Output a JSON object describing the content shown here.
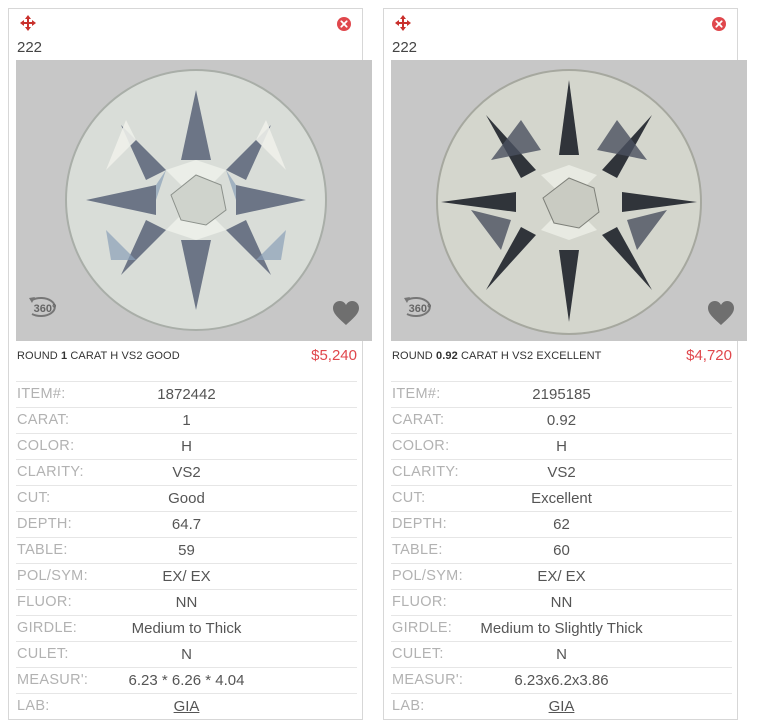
{
  "colors": {
    "price": "#e0474c",
    "close": "#e0474c",
    "move": "#c9302c",
    "label": "#b2b2b2"
  },
  "cards": [
    {
      "number": "222",
      "shape": "ROUND",
      "carat": "1",
      "desc_rest": "CARAT H VS2 GOOD",
      "price": "$5,240",
      "icons": {
        "move": "move-icon",
        "close": "close-icon",
        "view360": "360-view-icon",
        "fav": "heart-icon"
      },
      "specs": [
        {
          "label": "ITEM#:",
          "value": "1872442"
        },
        {
          "label": "CARAT:",
          "value": "1"
        },
        {
          "label": "COLOR:",
          "value": "H"
        },
        {
          "label": "CLARITY:",
          "value": "VS2"
        },
        {
          "label": "CUT:",
          "value": "Good"
        },
        {
          "label": "DEPTH:",
          "value": "64.7"
        },
        {
          "label": "TABLE:",
          "value": "59"
        },
        {
          "label": "POL/SYM:",
          "value": "EX/ EX"
        },
        {
          "label": "FLUOR:",
          "value": "NN"
        },
        {
          "label": "GIRDLE:",
          "value": "Medium to Thick"
        },
        {
          "label": "CULET:",
          "value": "N"
        },
        {
          "label": "MEASUR':",
          "value": "6.23 * 6.26 * 4.04"
        },
        {
          "label": "LAB:",
          "value": "GIA"
        }
      ]
    },
    {
      "number": "222",
      "shape": "ROUND",
      "carat": "0.92",
      "desc_rest": "CARAT H VS2 EXCELLENT",
      "price": "$4,720",
      "icons": {
        "move": "move-icon",
        "close": "close-icon",
        "view360": "360-view-icon",
        "fav": "heart-icon"
      },
      "specs": [
        {
          "label": "ITEM#:",
          "value": "2195185"
        },
        {
          "label": "CARAT:",
          "value": "0.92"
        },
        {
          "label": "COLOR:",
          "value": "H"
        },
        {
          "label": "CLARITY:",
          "value": "VS2"
        },
        {
          "label": "CUT:",
          "value": "Excellent"
        },
        {
          "label": "DEPTH:",
          "value": "62"
        },
        {
          "label": "TABLE:",
          "value": "60"
        },
        {
          "label": "POL/SYM:",
          "value": "EX/ EX"
        },
        {
          "label": "FLUOR:",
          "value": "NN"
        },
        {
          "label": "GIRDLE:",
          "value": "Medium to Slightly Thick"
        },
        {
          "label": "CULET:",
          "value": "N"
        },
        {
          "label": "MEASUR':",
          "value": "6.23x6.2x3.86"
        },
        {
          "label": "LAB:",
          "value": "GIA"
        }
      ]
    }
  ]
}
